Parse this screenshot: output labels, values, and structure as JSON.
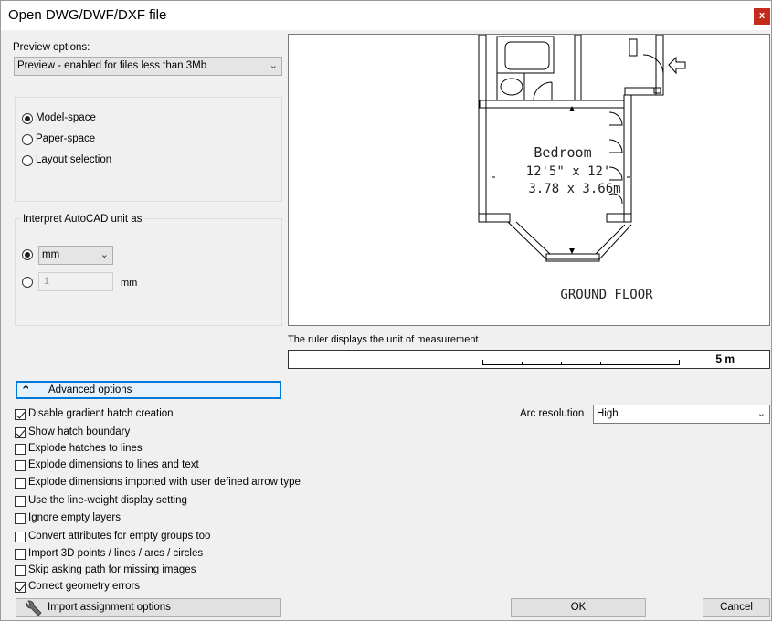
{
  "window": {
    "title": "Open DWG/DWF/DXF file",
    "close_glyph": "x"
  },
  "preview_options": {
    "label": "Preview options:",
    "selected": "Preview - enabled for files less than 3Mb"
  },
  "space": {
    "model_space": "Model-space",
    "paper_space": "Paper-space",
    "layout_selection": "Layout selection"
  },
  "units": {
    "group_label": "Interpret AutoCAD unit as",
    "unit_selected": "mm",
    "custom_value": "1",
    "custom_unit": "mm"
  },
  "floorplan": {
    "room_name": "Bedroom",
    "room_dims_imperial": "12'5\" x 12'",
    "room_dims_metric": "3.78 x 3.66m",
    "floor_label": "GROUND FLOOR"
  },
  "ruler": {
    "caption": "The ruler displays the unit of measurement",
    "scale_label": "5 m"
  },
  "advanced_button": "Advanced options",
  "options": [
    {
      "label": "Disable gradient hatch creation",
      "checked": true
    },
    {
      "label": "Show hatch boundary",
      "checked": true
    },
    {
      "label": "Explode hatches to lines",
      "checked": false
    },
    {
      "label": "Explode dimensions to lines and text",
      "checked": false
    },
    {
      "label": "Explode dimensions imported with user defined arrow type",
      "checked": false
    },
    {
      "label": "Use the line-weight display setting",
      "checked": false
    },
    {
      "label": "Ignore empty layers",
      "checked": false
    },
    {
      "label": "Convert attributes for empty groups too",
      "checked": false
    },
    {
      "label": "Import 3D points / lines / arcs / circles",
      "checked": false
    },
    {
      "label": "Skip asking path for missing images",
      "checked": false
    },
    {
      "label": "Correct geometry errors",
      "checked": true
    }
  ],
  "arc_resolution": {
    "label": "Arc resolution",
    "selected": "High"
  },
  "buttons": {
    "import_assignment": "Import assignment options",
    "ok": "OK",
    "cancel": "Cancel"
  },
  "icons": {
    "close": "close-icon",
    "caret": "chevron-down-icon",
    "advanced": "double-chevron-up-icon",
    "import": "wrench-icon"
  },
  "colors": {
    "close_red": "#c42b1c",
    "focus_blue": "#0078d7",
    "dialog_bg": "#f0f0f0"
  }
}
